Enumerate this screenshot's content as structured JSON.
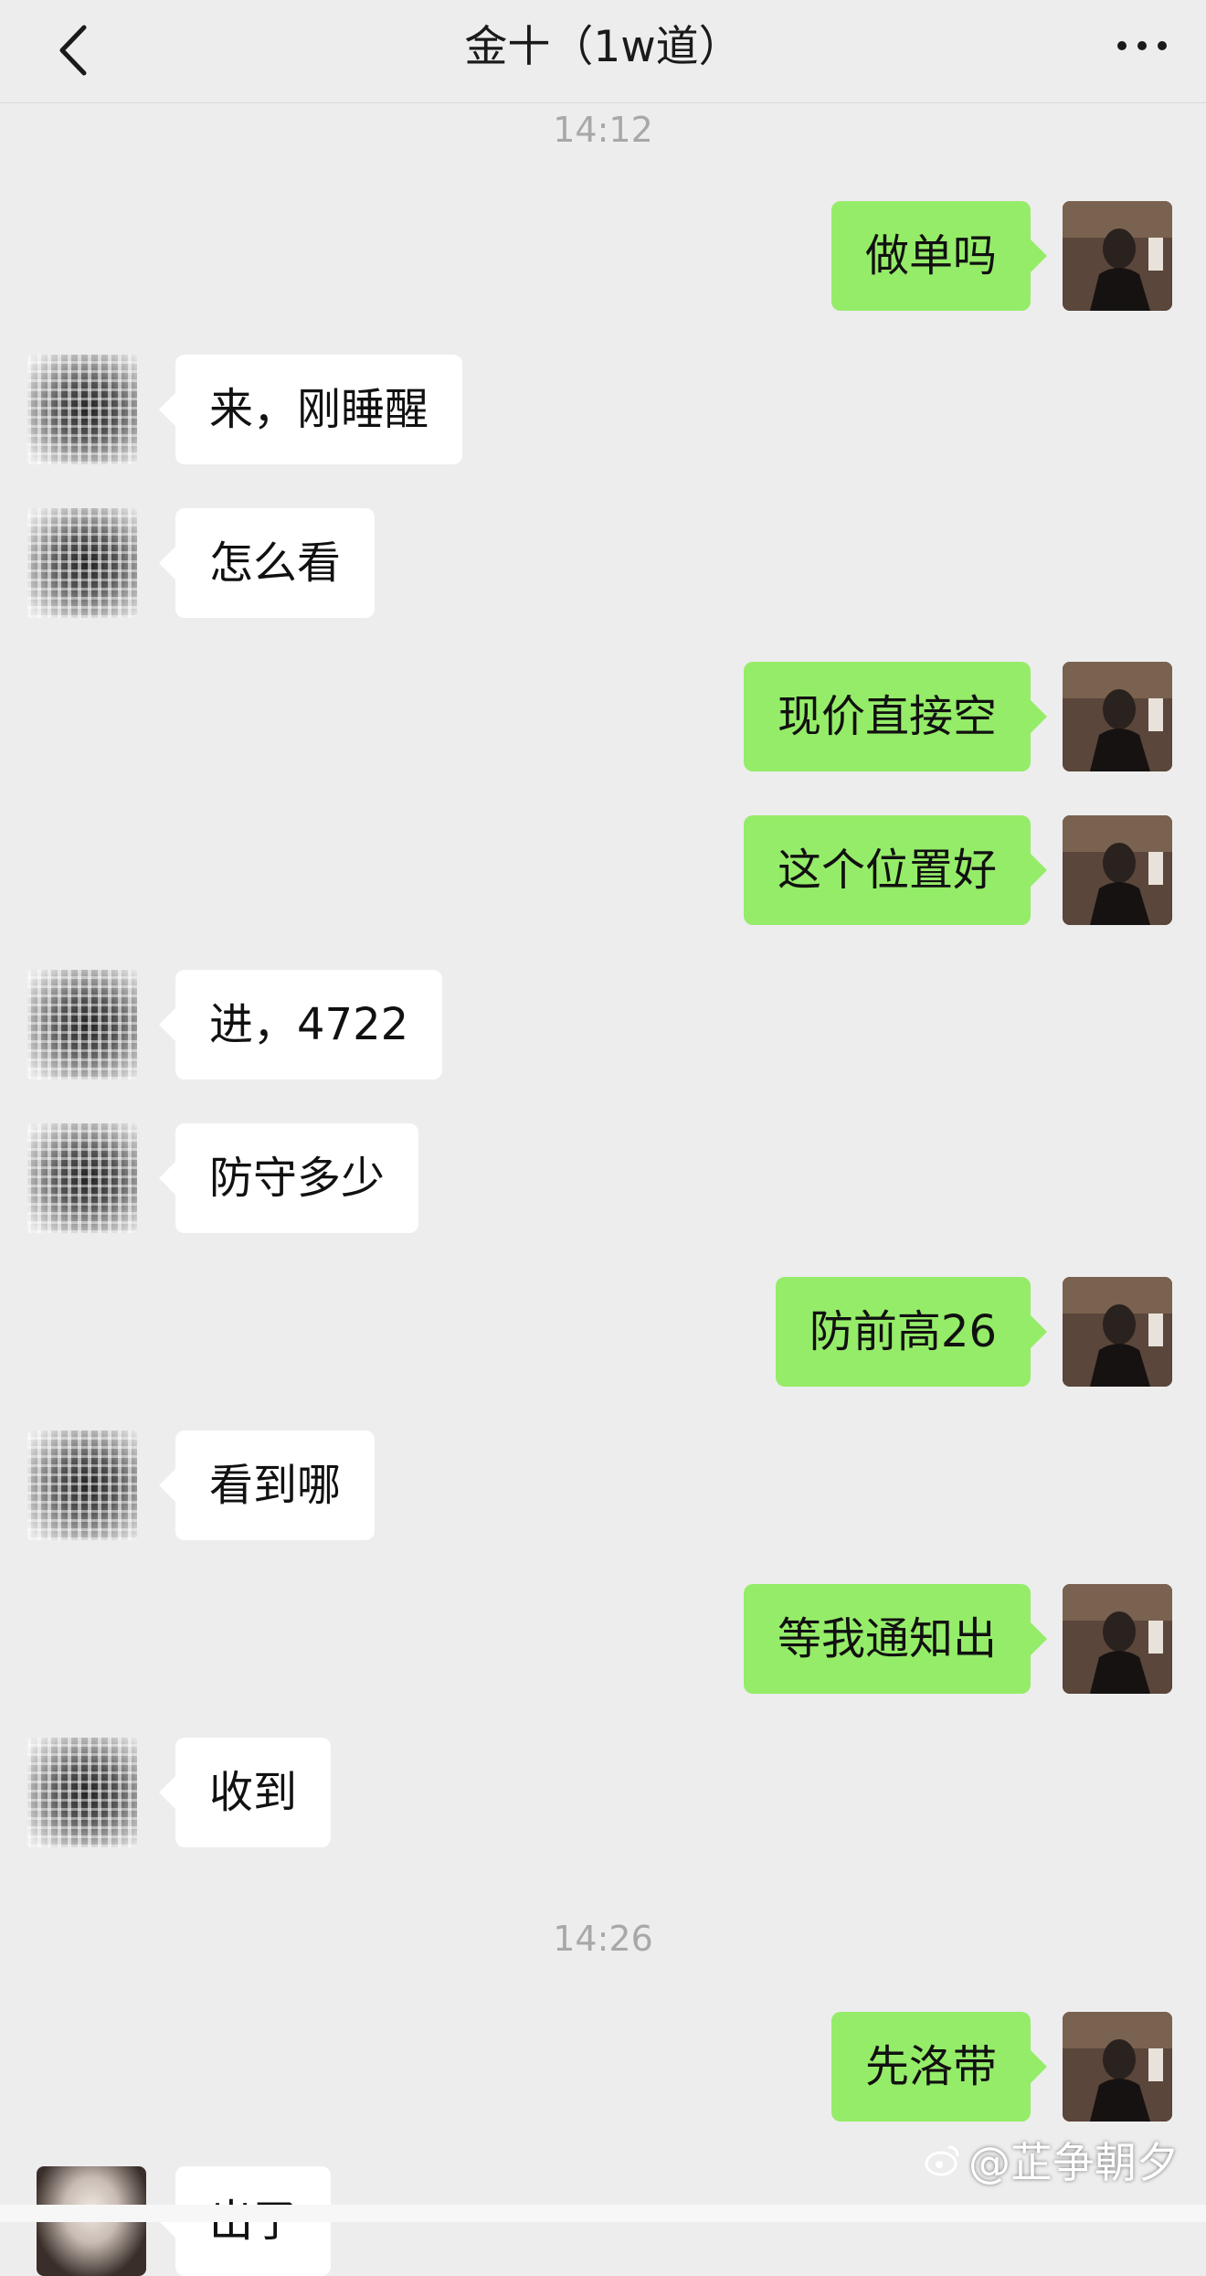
{
  "header": {
    "title": "金十（1w道）"
  },
  "messages": [
    {
      "type": "time",
      "text": "14:12"
    },
    {
      "type": "msg",
      "side": "me",
      "text": "做单吗"
    },
    {
      "type": "msg",
      "side": "other",
      "text": "来，刚睡醒"
    },
    {
      "type": "msg",
      "side": "other",
      "text": "怎么看"
    },
    {
      "type": "msg",
      "side": "me",
      "text": "现价直接空"
    },
    {
      "type": "msg",
      "side": "me",
      "text": "这个位置好"
    },
    {
      "type": "msg",
      "side": "other",
      "text": "进，4722"
    },
    {
      "type": "msg",
      "side": "other",
      "text": "防守多少"
    },
    {
      "type": "msg",
      "side": "me",
      "text": "防前高26"
    },
    {
      "type": "msg",
      "side": "other",
      "text": "看到哪"
    },
    {
      "type": "msg",
      "side": "me",
      "text": "等我通知出"
    },
    {
      "type": "msg",
      "side": "other",
      "text": "收到"
    },
    {
      "type": "time",
      "text": "14:26"
    },
    {
      "type": "msg",
      "side": "me",
      "text": "先洛带"
    },
    {
      "type": "msg",
      "side": "other",
      "text": "出了"
    }
  ],
  "watermark": "@芷争朝夕",
  "icons": {
    "back": "chevron-left-icon",
    "more": "more-dots-icon",
    "watermark": "weibo-icon"
  },
  "colors": {
    "background": "#ededed",
    "my_bubble": "#95ec69",
    "their_bubble": "#ffffff"
  }
}
